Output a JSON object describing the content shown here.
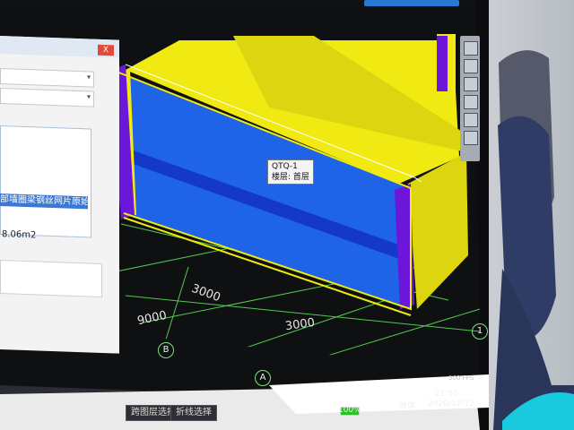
{
  "scene": {
    "monitor_bg": "#2a2c33",
    "screen_bg": "#0f1012",
    "grid_color": "#56d356",
    "wall_front_color": "#1f63e6",
    "wall_top_color": "#f0ea12",
    "column_color": "#6b16d9"
  },
  "dimensions": {
    "top": "3000",
    "left": "9000",
    "bottom": "3000"
  },
  "axis_labels": {
    "b": "B",
    "a": "A",
    "one": "1"
  },
  "tooltip": {
    "line1": "QTQ-1",
    "line2": "楼层: 首层"
  },
  "left_panel": {
    "selected_text": "部墙圈梁钢丝网片原始",
    "area": "8.06m2",
    "close": "X"
  },
  "statusbar": {
    "fps": "500 FPS",
    "battery": "100%",
    "time": "21:50",
    "date": "2020/12/12",
    "ime": "简体",
    "battery_level": 1.0
  },
  "bottom_tabs": {
    "tab1": "跨图层选择",
    "tab2": "折线选择"
  }
}
